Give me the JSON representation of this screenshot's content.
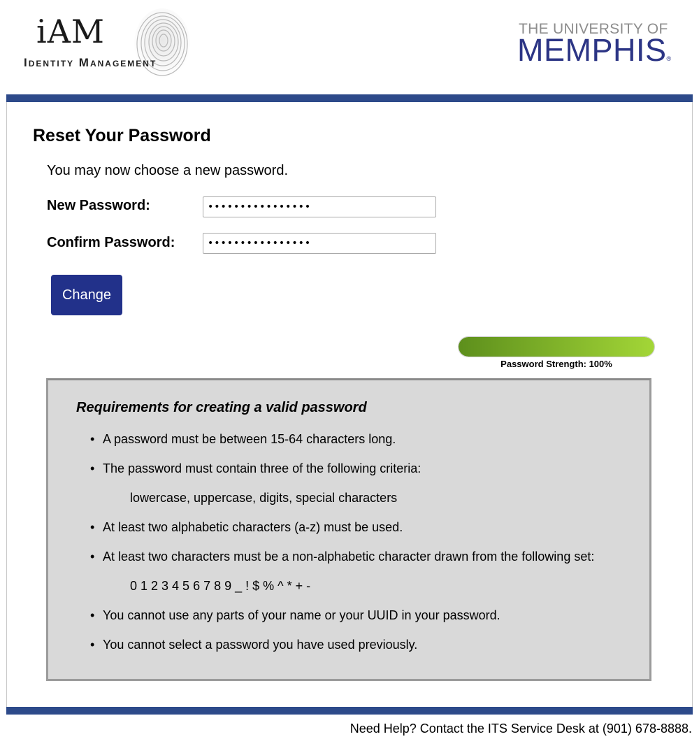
{
  "header": {
    "iam_logo": {
      "title": "iAM",
      "subtitle": "Identity Management",
      "icon": "fingerprint-icon"
    },
    "university_logo": {
      "line1": "THE UNIVERSITY OF",
      "line2": "MEMPHIS",
      "mark": "®"
    }
  },
  "colors": {
    "brand_bar": "#2d4a8a",
    "button": "#22318a",
    "university_blue": "#2c3585",
    "strength_start": "#5d8f1c",
    "strength_end": "#a3d637",
    "requirements_bg": "#d9d9d9"
  },
  "main": {
    "title": "Reset Your Password",
    "intro": "You may now choose a new password.",
    "form": {
      "new_password_label": "New Password:",
      "new_password_value": "••••••••••••••••",
      "confirm_password_label": "Confirm Password:",
      "confirm_password_value": "••••••••••••••••",
      "submit_label": "Change"
    },
    "strength": {
      "label": "Password Strength: 100%",
      "percent": 100
    }
  },
  "requirements": {
    "title": "Requirements for creating a valid password",
    "items": [
      {
        "text": "A password must be between 15-64 characters long."
      },
      {
        "text": "The password must contain three of the following criteria:",
        "sub": "lowercase, uppercase, digits, special characters"
      },
      {
        "text": "At least two alphabetic characters (a-z) must be used."
      },
      {
        "text": "At least two characters must be a non-alphabetic character drawn from the following set:",
        "sub": "0 1 2 3 4 5 6 7 8 9 _ ! $ % ^ * + -"
      },
      {
        "text": "You cannot use any parts of your name or your UUID in your password."
      },
      {
        "text": "You cannot select a password you have used previously."
      }
    ]
  },
  "footer": {
    "help_text": "Need Help? Contact the ITS Service Desk at (901) 678-8888."
  }
}
